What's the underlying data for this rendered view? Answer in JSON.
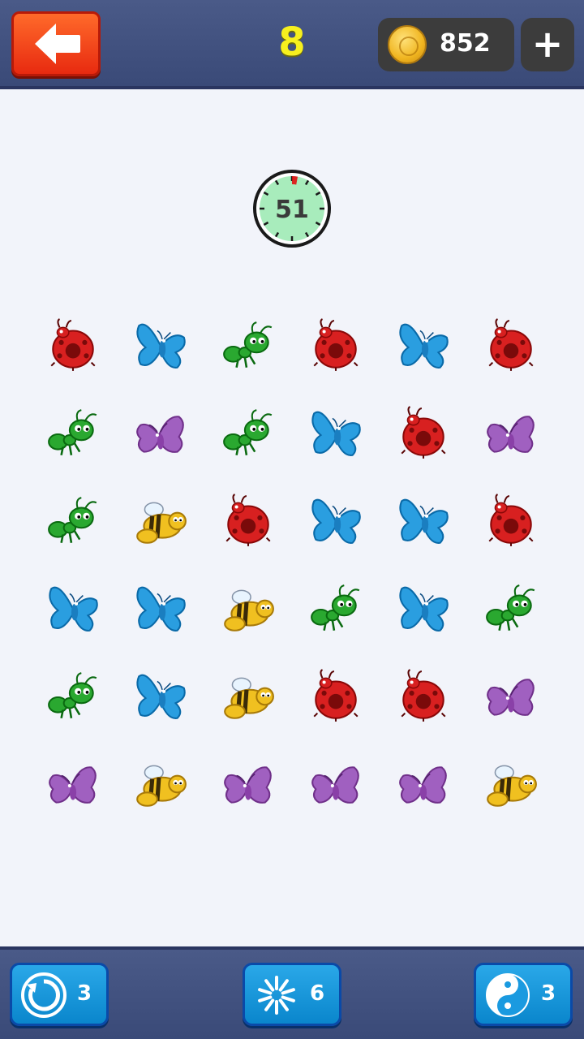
{
  "header": {
    "back_icon": "arrow-left-icon",
    "level": "8",
    "coins": "852",
    "coin_icon": "gold-coin-icon",
    "add_label": "+"
  },
  "timer": {
    "value": "51",
    "icon": "stopwatch-icon"
  },
  "board": {
    "rows": 6,
    "cols": 6,
    "tiles": [
      [
        "ladybug",
        "butterfly-blue",
        "ant",
        "ladybug",
        "butterfly-blue",
        "ladybug"
      ],
      [
        "ant",
        "butterfly-purple",
        "ant",
        "butterfly-blue",
        "ladybug",
        "butterfly-purple"
      ],
      [
        "ant",
        "bee",
        "ladybug",
        "butterfly-blue",
        "butterfly-blue",
        "ladybug"
      ],
      [
        "butterfly-blue",
        "butterfly-blue",
        "bee",
        "ant",
        "butterfly-blue",
        "ant"
      ],
      [
        "ant",
        "butterfly-blue",
        "bee",
        "ladybug",
        "ladybug",
        "butterfly-purple"
      ],
      [
        "butterfly-purple",
        "bee",
        "butterfly-purple",
        "butterfly-purple",
        "butterfly-purple",
        "bee"
      ]
    ]
  },
  "powerups": [
    {
      "name": "shuffle",
      "icon": "refresh-icon",
      "count": "3"
    },
    {
      "name": "burst",
      "icon": "burst-icon",
      "count": "6"
    },
    {
      "name": "yin-yang",
      "icon": "yin-yang-icon",
      "count": "3"
    }
  ],
  "colors": {
    "bar": "#3f4f7f",
    "back_button": "#f03a18",
    "level_text": "#f7f01e",
    "power_button": "#1a9ae0",
    "ladybug": "#d82020",
    "butterfly_blue": "#2a9ee0",
    "butterfly_purple": "#a060c0",
    "ant": "#2aa830",
    "bee": "#f0c020"
  }
}
